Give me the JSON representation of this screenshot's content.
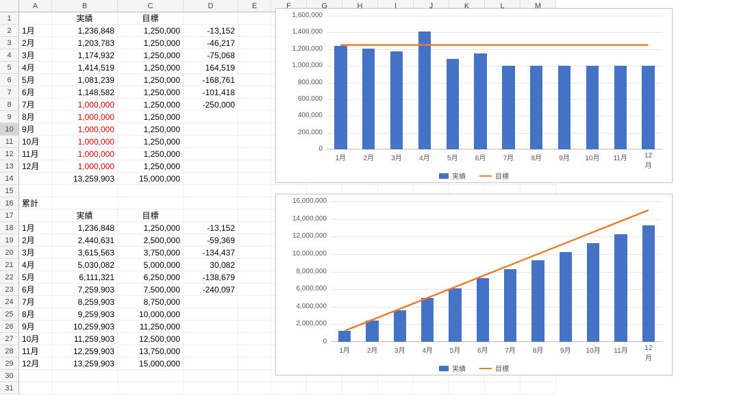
{
  "columns": [
    "A",
    "B",
    "C",
    "D",
    "E",
    "F",
    "G",
    "H",
    "I",
    "J",
    "K",
    "L",
    "M"
  ],
  "row_count": 31,
  "selected_row_header": 10,
  "labels": {
    "jisseki": "実績",
    "mokuhyo": "目標",
    "ruikei": "累計"
  },
  "months": [
    "1月",
    "2月",
    "3月",
    "4月",
    "5月",
    "6月",
    "7月",
    "8月",
    "9月",
    "10月",
    "11月",
    "12月"
  ],
  "monthly": {
    "actual": [
      "1,236,848",
      "1,203,783",
      "1,174,932",
      "1,414,519",
      "1,081,239",
      "1,148,582",
      "1,000,000",
      "1,000,000",
      "1,000,000",
      "1,000,000",
      "1,000,000",
      "1,000,000"
    ],
    "actual_red_from": 6,
    "target": [
      "1,250,000",
      "1,250,000",
      "1,250,000",
      "1,250,000",
      "1,250,000",
      "1,250,000",
      "1,250,000",
      "1,250,000",
      "1,250,000",
      "1,250,000",
      "1,250,000",
      "1,250,000"
    ],
    "diff": [
      "-13,152",
      "-46,217",
      "-75,068",
      "164,519",
      "-168,761",
      "-101,418",
      "-250,000",
      "",
      "",
      "",
      "",
      ""
    ],
    "sum_actual": "13,259,903",
    "sum_target": "15,000,000"
  },
  "cumulative": {
    "actual": [
      "1,236,848",
      "2,440,631",
      "3,615,563",
      "5,030,082",
      "6,111,321",
      "7,259,903",
      "8,259,903",
      "9,259,903",
      "10,259,903",
      "11,259,903",
      "12,259,903",
      "13,259,903"
    ],
    "target": [
      "1,250,000",
      "2,500,000",
      "3,750,000",
      "5,000,000",
      "6,250,000",
      "7,500,000",
      "8,750,000",
      "10,000,000",
      "11,250,000",
      "12,500,000",
      "13,750,000",
      "15,000,000"
    ],
    "diff": [
      "-13,152",
      "-59,369",
      "-134,437",
      "30,082",
      "-138,679",
      "-240,097",
      "",
      "",
      "",
      "",
      "",
      ""
    ]
  },
  "chart_data": [
    {
      "type": "bar+line",
      "categories": [
        "1月",
        "2月",
        "3月",
        "4月",
        "5月",
        "6月",
        "7月",
        "8月",
        "9月",
        "10月",
        "11月",
        "12月"
      ],
      "series": [
        {
          "name": "実績",
          "kind": "bar",
          "values": [
            1236848,
            1203783,
            1174932,
            1414519,
            1081239,
            1148582,
            1000000,
            1000000,
            1000000,
            1000000,
            1000000,
            1000000
          ]
        },
        {
          "name": "目標",
          "kind": "line",
          "values": [
            1250000,
            1250000,
            1250000,
            1250000,
            1250000,
            1250000,
            1250000,
            1250000,
            1250000,
            1250000,
            1250000,
            1250000
          ]
        }
      ],
      "y_ticks": [
        0,
        200000,
        400000,
        600000,
        800000,
        1000000,
        1200000,
        1400000,
        1600000
      ],
      "ylim": [
        0,
        1600000
      ]
    },
    {
      "type": "bar+line",
      "categories": [
        "1月",
        "2月",
        "3月",
        "4月",
        "5月",
        "6月",
        "7月",
        "8月",
        "9月",
        "10月",
        "11月",
        "12月"
      ],
      "series": [
        {
          "name": "実績",
          "kind": "bar",
          "values": [
            1236848,
            2440631,
            3615563,
            5030082,
            6111321,
            7259903,
            8259903,
            9259903,
            10259903,
            11259903,
            12259903,
            13259903
          ]
        },
        {
          "name": "目標",
          "kind": "line",
          "values": [
            1250000,
            2500000,
            3750000,
            5000000,
            6250000,
            7500000,
            8750000,
            10000000,
            11250000,
            12500000,
            13750000,
            15000000
          ]
        }
      ],
      "y_ticks": [
        0,
        2000000,
        4000000,
        6000000,
        8000000,
        10000000,
        12000000,
        14000000,
        16000000
      ],
      "ylim": [
        0,
        16000000
      ]
    }
  ],
  "chart_colors": {
    "bar": "#4472c4",
    "line": "#ed7d31"
  }
}
